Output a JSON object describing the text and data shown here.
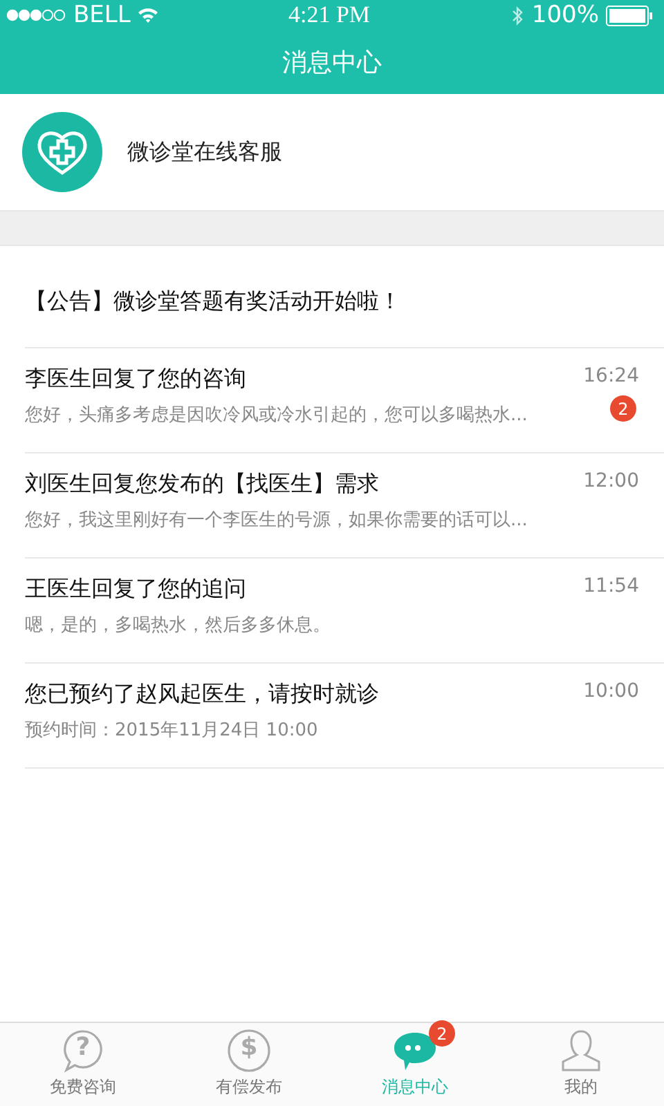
{
  "status_bar": {
    "carrier": "BELL",
    "time": "4:21 PM",
    "battery": "100%"
  },
  "nav_bar": {
    "title": "消息中心"
  },
  "service": {
    "name": "微诊堂在线客服"
  },
  "announcement": "【公告】微诊堂答题有奖活动开始啦！",
  "messages": [
    {
      "title": "李医生回复了您的咨询",
      "preview": "您好，头痛多考虑是因吹冷风或冷水引起的，您可以多喝热水...",
      "time": "16:24",
      "badge": "2"
    },
    {
      "title": "刘医生回复您发布的【找医生】需求",
      "preview": "您好，我这里刚好有一个李医生的号源，如果你需要的话可以...",
      "time": "12:00"
    },
    {
      "title": "王医生回复了您的追问",
      "preview": "嗯，是的，多喝热水，然后多多休息。",
      "time": "11:54"
    },
    {
      "title": "您已预约了赵风起医生，请按时就诊",
      "preview": "预约时间：2015年11月24日 10:00",
      "time": "10:00"
    }
  ],
  "tab_bar": [
    {
      "label": "免费咨询",
      "kind": "question",
      "glyph": "?",
      "selected": false
    },
    {
      "label": "有偿发布",
      "kind": "dollar",
      "glyph": "$",
      "selected": false
    },
    {
      "label": "消息中心",
      "kind": "chat",
      "selected": true,
      "badge": "2"
    },
    {
      "label": "我的",
      "kind": "person",
      "selected": false
    }
  ]
}
